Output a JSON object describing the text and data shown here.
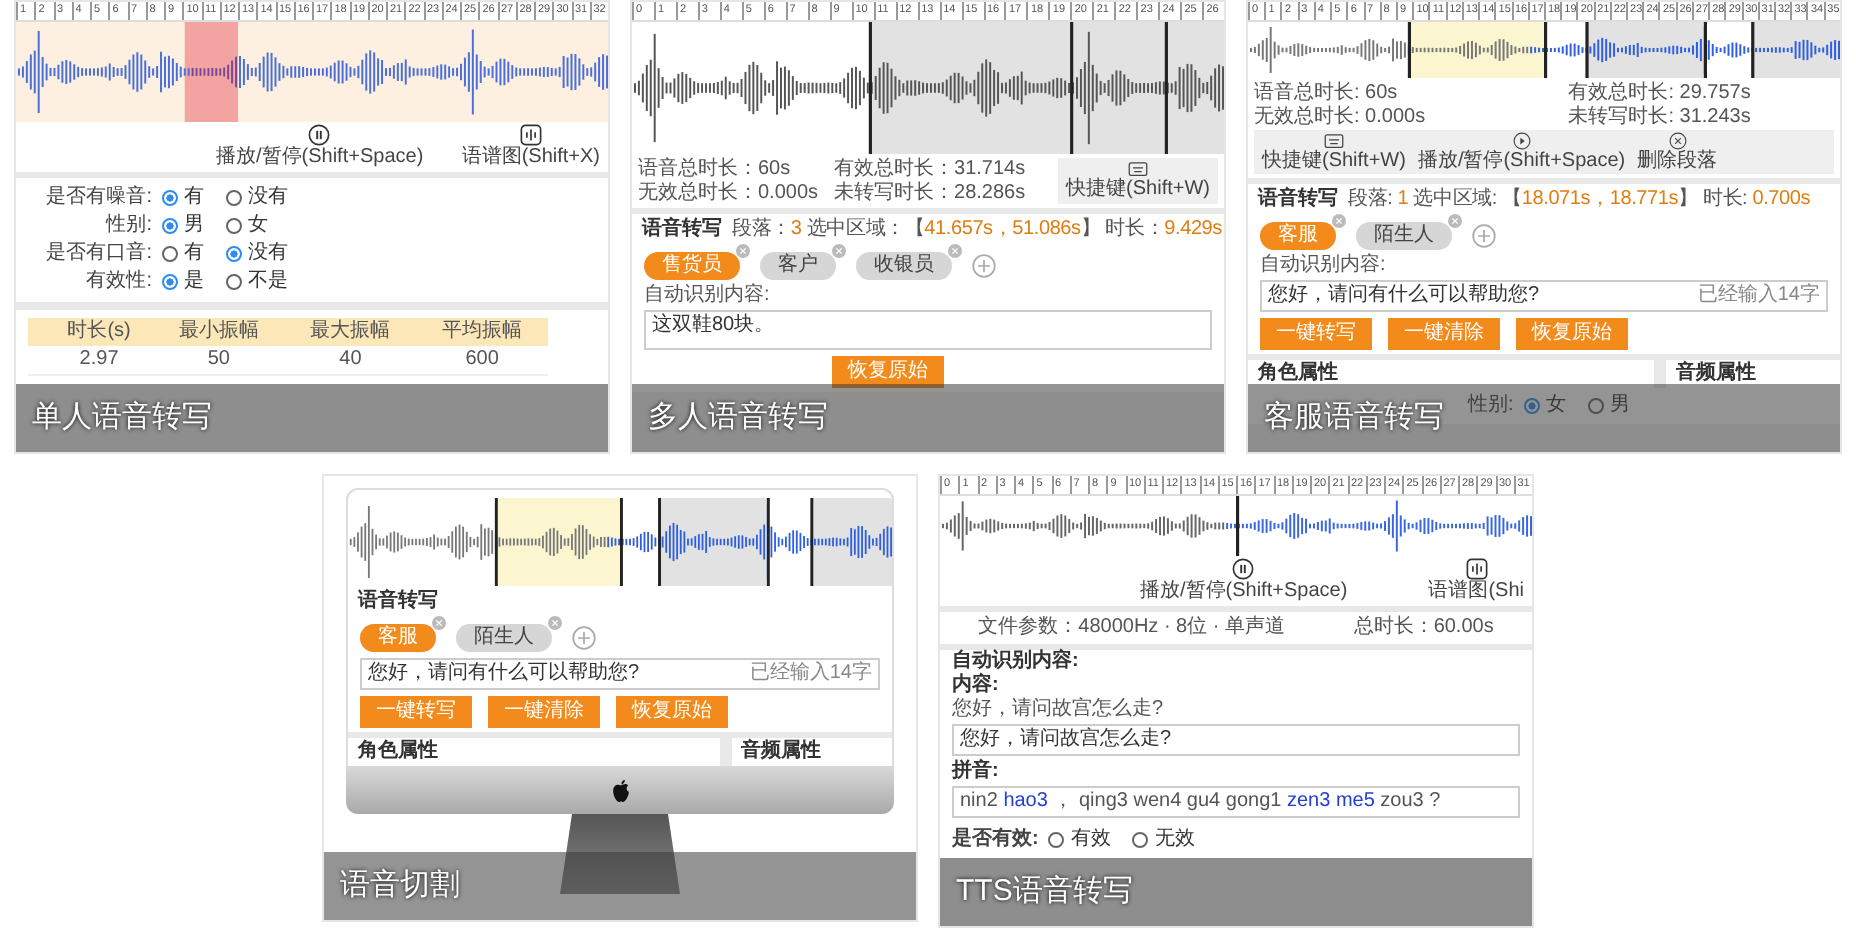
{
  "cards": [
    {
      "caption": "单人语音转写",
      "kind": "plain",
      "sections": [
        {
          "kind": "ruler",
          "labels": [
            "1",
            "2",
            "3",
            "4",
            "5",
            "6",
            "7",
            "8",
            "9",
            "10",
            "11",
            "12",
            "13",
            "14",
            "15",
            "16",
            "17",
            "18",
            "19",
            "20",
            "21",
            "22",
            "23",
            "24",
            "25",
            "26",
            "27",
            "28",
            "29",
            "30",
            "31",
            "32"
          ]
        },
        {
          "kind": "wave"
        },
        {
          "kind": "controls",
          "items": [
            "播放/暂停(Shift+Space)",
            "语谱图(Shift+X)"
          ]
        },
        {
          "kind": "radios",
          "rows": [
            {
              "label": "是否有噪音:",
              "options": [
                {
                  "label": "有",
                  "selected": true
                },
                {
                  "label": "没有",
                  "selected": false
                }
              ]
            },
            {
              "label": "性别:",
              "options": [
                {
                  "label": "男",
                  "selected": true
                },
                {
                  "label": "女",
                  "selected": false
                }
              ]
            },
            {
              "label": "是否有口音:",
              "options": [
                {
                  "label": "有",
                  "selected": false
                },
                {
                  "label": "没有",
                  "selected": true
                }
              ]
            },
            {
              "label": "有效性:",
              "options": [
                {
                  "label": "是",
                  "selected": true
                },
                {
                  "label": "不是",
                  "selected": false
                }
              ]
            }
          ]
        },
        {
          "kind": "table",
          "columns": [
            "时长(s)",
            "最小振幅",
            "最大振幅",
            "平均振幅"
          ],
          "rows": [
            [
              "2.97",
              "50",
              "40",
              "600"
            ]
          ]
        }
      ]
    },
    {
      "caption": "多人语音转写",
      "kind": "plain",
      "sections": [
        {
          "kind": "ruler",
          "labels": [
            "0",
            "1",
            "2",
            "3",
            "4",
            "5",
            "6",
            "7",
            "8",
            "9",
            "10",
            "11",
            "12",
            "13",
            "14",
            "15",
            "16",
            "17",
            "18",
            "19",
            "20",
            "21",
            "22",
            "23",
            "24",
            "25",
            "26"
          ]
        },
        {
          "kind": "wave"
        },
        {
          "kind": "stats",
          "items": [
            "语音总时长：60s",
            "有效总时长：31.714s",
            "无效总时长：0.000s",
            "未转写时长：28.286s"
          ],
          "tools": [
            "快捷键(Shift+W)"
          ]
        },
        {
          "kind": "transcribe",
          "title": "语音转写",
          "parts": [
            {
              "text": "段落：",
              "accent": false
            },
            {
              "text": "3",
              "accent": true
            },
            {
              "text": " 选中区域：【",
              "accent": false
            },
            {
              "text": "41.657s，51.086s",
              "accent": true
            },
            {
              "text": "】 时长：",
              "accent": false
            },
            {
              "text": "9.429s",
              "accent": true
            }
          ]
        },
        {
          "kind": "chips",
          "add": true,
          "items": [
            {
              "label": "售货员",
              "selected": true
            },
            {
              "label": "客户",
              "selected": false
            },
            {
              "label": "收银员",
              "selected": false
            }
          ]
        },
        {
          "kind": "label",
          "text": "自动识别内容:",
          "bold": false
        },
        {
          "kind": "textarea",
          "value": "这双鞋80块。"
        },
        {
          "kind": "buttons",
          "items": [
            "恢复原始"
          ]
        }
      ]
    },
    {
      "caption": "客服语音转写",
      "kind": "plain",
      "sections": [
        {
          "kind": "ruler",
          "labels": [
            "0",
            "1",
            "2",
            "3",
            "4",
            "5",
            "6",
            "7",
            "8",
            "9",
            "10",
            "11",
            "12",
            "13",
            "14",
            "15",
            "16",
            "17",
            "18",
            "19",
            "20",
            "21",
            "22",
            "23",
            "24",
            "25",
            "26",
            "27",
            "28",
            "29",
            "30",
            "31",
            "32",
            "33",
            "34",
            "35"
          ]
        },
        {
          "kind": "wave"
        },
        {
          "kind": "stats",
          "items": [
            "语音总时长: 60s",
            "有效总时长: 29.757s",
            "无效总时长: 0.000s",
            "未转写时长: 31.243s"
          ],
          "tools": [
            "快捷键(Shift+W)",
            "播放/暂停(Shift+Space)",
            "删除段落"
          ]
        },
        {
          "kind": "transcribe",
          "title": "语音转写",
          "parts": [
            {
              "text": "段落: ",
              "accent": false
            },
            {
              "text": "1",
              "accent": true
            },
            {
              "text": " 选中区域: 【",
              "accent": false
            },
            {
              "text": "18.071s，18.771s",
              "accent": true
            },
            {
              "text": "】 时长: ",
              "accent": false
            },
            {
              "text": "0.700s",
              "accent": true
            }
          ]
        },
        {
          "kind": "chips",
          "add": true,
          "items": [
            {
              "label": "客服",
              "selected": true
            },
            {
              "label": "陌生人",
              "selected": false
            }
          ]
        },
        {
          "kind": "label",
          "text": "自动识别内容:",
          "bold": false
        },
        {
          "kind": "textarea",
          "value": "您好，请问有什么可以帮助您?",
          "counter": "已经输入14字"
        },
        {
          "kind": "buttons",
          "items": [
            "一键转写",
            "一键清除",
            "恢复原始"
          ]
        },
        {
          "kind": "split",
          "left": "角色属性",
          "right": "音频属性"
        },
        {
          "kind": "radios",
          "rows": [
            {
              "label": "性别:",
              "options": [
                {
                  "label": "女",
                  "selected": true
                },
                {
                  "label": "男",
                  "selected": false
                }
              ]
            }
          ]
        }
      ]
    },
    {
      "caption": "语音切割",
      "kind": "monitor",
      "sections": [
        {
          "kind": "wave"
        },
        {
          "kind": "transcribe",
          "title": "语音转写"
        },
        {
          "kind": "chips",
          "add": true,
          "items": [
            {
              "label": "客服",
              "selected": true
            },
            {
              "label": "陌生人",
              "selected": false
            }
          ]
        },
        {
          "kind": "textarea",
          "value": "您好，请问有什么可以帮助您?",
          "counter": "已经输入14字"
        },
        {
          "kind": "buttons",
          "items": [
            "一键转写",
            "一键清除",
            "恢复原始"
          ]
        },
        {
          "kind": "split",
          "left": "角色属性",
          "right": "音频属性"
        }
      ]
    },
    {
      "caption": "TTS语音转写",
      "kind": "plain",
      "sections": [
        {
          "kind": "ruler",
          "labels": [
            "0",
            "1",
            "2",
            "3",
            "4",
            "5",
            "6",
            "7",
            "8",
            "9",
            "10",
            "11",
            "12",
            "13",
            "14",
            "15",
            "16",
            "17",
            "18",
            "19",
            "20",
            "21",
            "22",
            "23",
            "24",
            "25",
            "26",
            "27",
            "28",
            "29",
            "30",
            "31"
          ]
        },
        {
          "kind": "wave"
        },
        {
          "kind": "controls",
          "items": [
            "播放/暂停(Shift+Space)",
            "语谱图(Shi"
          ]
        },
        {
          "kind": "info",
          "items": [
            "文件参数：48000Hz · 8位 · 单声道",
            "总时长：60.00s"
          ]
        },
        {
          "kind": "label",
          "text": "自动识别内容:",
          "bold": true
        },
        {
          "kind": "label",
          "text": "内容:",
          "bold": true
        },
        {
          "kind": "label",
          "text": "您好，请问故宫怎么走?",
          "bold": false
        },
        {
          "kind": "textarea",
          "value": "您好，请问故宫怎么走?"
        },
        {
          "kind": "label",
          "text": "拼音:",
          "bold": true
        },
        {
          "kind": "pinyin",
          "parts": [
            {
              "text": "nin2 ",
              "accent": false
            },
            {
              "text": "hao3",
              "accent": true
            },
            {
              "text": " ， qing3 wen4 gu4 gong1 ",
              "accent": false
            },
            {
              "text": "zen3 me5",
              "accent": true
            },
            {
              "text": " zou3 ?",
              "accent": false
            }
          ]
        },
        {
          "kind": "radios",
          "rows": [
            {
              "label": "是否有效:",
              "options": [
                {
                  "label": "有效",
                  "selected": false
                },
                {
                  "label": "无效",
                  "selected": false
                }
              ]
            }
          ]
        }
      ]
    }
  ]
}
